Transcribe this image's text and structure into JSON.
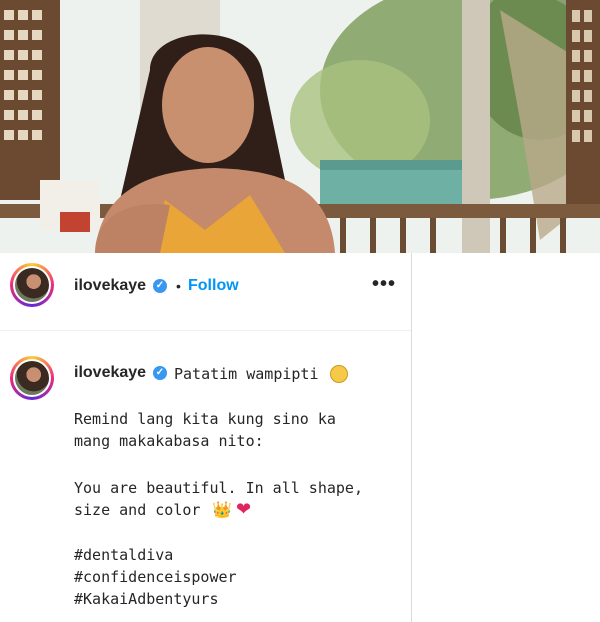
{
  "post": {
    "username": "ilovekaye",
    "follow_label": "Follow",
    "separator": "•",
    "more_label": "•••"
  },
  "caption": {
    "username": "ilovekaye",
    "headline": "Patatim wampipti",
    "lines": [
      "Remind lang kita kung sino ka",
      "mang makakabasa nito:",
      "You are beautiful. In all shape,",
      "size and color",
      "#dentaldiva",
      "#confidenceispower",
      "#KakaiAdbentyurs"
    ]
  },
  "colors": {
    "accent": "#0095f6",
    "verified": "#3897f0",
    "text": "#262626"
  },
  "icons": [
    "verified-badge-icon",
    "laughing-emoji-icon",
    "crown-emoji-icon",
    "heart-emoji-icon",
    "more-options-icon"
  ]
}
